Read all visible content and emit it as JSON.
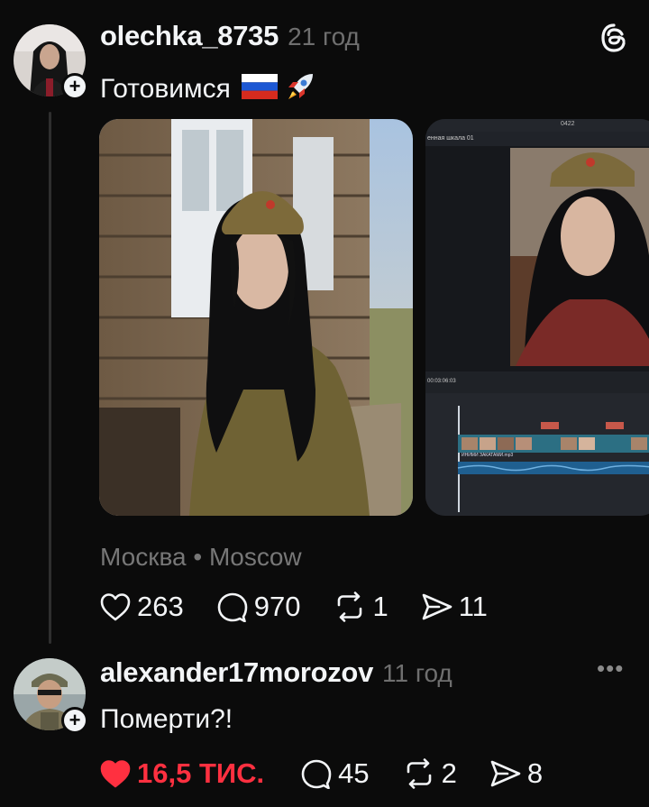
{
  "post": {
    "username": "olechka_8735",
    "time": "21 год",
    "text": "Готовимся",
    "flag_emoji": "🇷🇺",
    "rocket_emoji": "🚀",
    "location": "Москва • Moscow",
    "likes": "263",
    "comments": "970",
    "reposts": "1",
    "shares": "11",
    "editor": {
      "window_title": "0422",
      "timeline_label": "енная шкала 01",
      "timecode": "00:03:06:03",
      "clip_label": "ИНИМИ ЗАКАТАМИ.mp3"
    }
  },
  "reply": {
    "username": "alexander17morozov",
    "time": "11 год",
    "text": "Померти?!",
    "likes": "16,5 ТИС.",
    "comments": "45",
    "reposts": "2",
    "shares": "8",
    "more": "•••"
  },
  "colors": {
    "background": "#0b0b0b",
    "text": "#f3f5f7",
    "muted": "#6f6f6f",
    "liked": "#ff3040"
  },
  "icons": [
    "threads-logo-icon",
    "plus-icon",
    "heart-icon",
    "comment-icon",
    "repost-icon",
    "share-icon",
    "more-icon"
  ]
}
